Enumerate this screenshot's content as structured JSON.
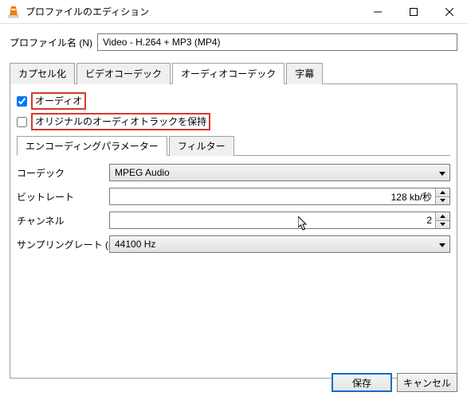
{
  "window": {
    "title": "プロファイルのエディション"
  },
  "profile": {
    "name_label": "プロファイル名 (N)",
    "name_value": "Video - H.264 + MP3 (MP4)"
  },
  "tabs": {
    "encapsulation": "カプセル化",
    "video_codec": "ビデオコーデック",
    "audio_codec": "オーディオコーデック",
    "subtitles": "字幕"
  },
  "audio": {
    "audio_checkbox_label": "オーディオ",
    "keep_original_label": "オリジナルのオーディオトラックを保持"
  },
  "subtabs": {
    "encoding_params": "エンコーディングパラメーター",
    "filter": "フィルター"
  },
  "form": {
    "codec_label": "コーデック",
    "codec_value": "MPEG Audio",
    "bitrate_label": "ビットレート",
    "bitrate_value": "128 kb/秒",
    "channel_label": "チャンネル",
    "channel_value": "2",
    "samplerate_label": "サンプリングレート (m)",
    "samplerate_value": "44100 Hz"
  },
  "buttons": {
    "save": "保存",
    "cancel": "キャンセル"
  }
}
